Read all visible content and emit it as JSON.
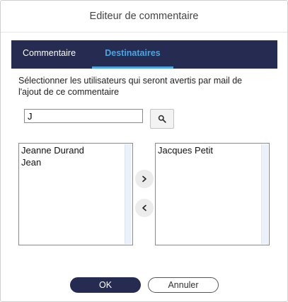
{
  "dialog": {
    "title": "Editeur de commentaire"
  },
  "tabs": [
    {
      "label": "Commentaire",
      "active": false
    },
    {
      "label": "Destinataires",
      "active": true
    }
  ],
  "instructions": "Sélectionner les utilisateurs qui seront avertis par mail de l'ajout de ce commentaire",
  "search": {
    "value": "J",
    "button_icon": "search-icon"
  },
  "available_users": [
    "Jeanne Durand",
    "Jean"
  ],
  "selected_users": [
    "Jacques Petit"
  ],
  "transfer": {
    "add_icon": "chevron-right-icon",
    "remove_icon": "chevron-left-icon"
  },
  "buttons": {
    "ok_label": "OK",
    "cancel_label": "Annuler"
  },
  "colors": {
    "header_bg": "#262c51",
    "active_tab": "#4aa6e0",
    "ok_button": "#262c51"
  }
}
